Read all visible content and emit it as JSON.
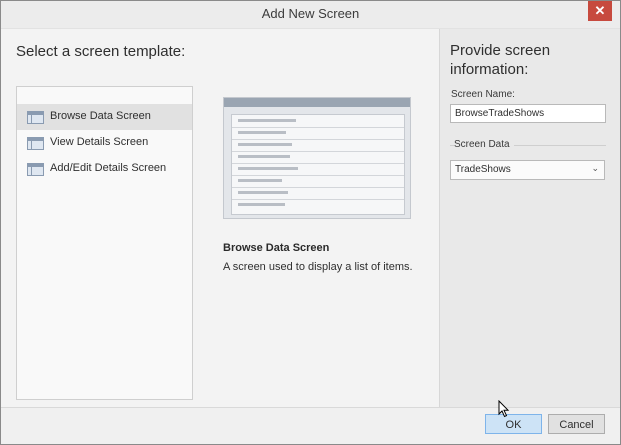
{
  "window": {
    "title": "Add New Screen",
    "close_glyph": "✕"
  },
  "left": {
    "heading": "Select a screen template:",
    "templates": [
      {
        "label": "Browse Data Screen",
        "icon": "browse-data-icon",
        "selected": true
      },
      {
        "label": "View Details Screen",
        "icon": "view-details-icon",
        "selected": false
      },
      {
        "label": "Add/Edit Details Screen",
        "icon": "add-edit-details-icon",
        "selected": false
      }
    ]
  },
  "preview": {
    "title": "Browse Data Screen",
    "description": "A screen used to display a list of items."
  },
  "right": {
    "heading": "Provide screen information:",
    "screen_name_label": "Screen Name:",
    "screen_name_value": "BrowseTradeShows",
    "screen_data_label": "Screen Data",
    "screen_data_value": "TradeShows",
    "chevron_glyph": "⌄"
  },
  "footer": {
    "ok_label": "OK",
    "cancel_label": "Cancel"
  },
  "colors": {
    "selected_item": "#e1e1e1",
    "ok_button": "#cde3f6",
    "close_button": "#c74a3e"
  }
}
